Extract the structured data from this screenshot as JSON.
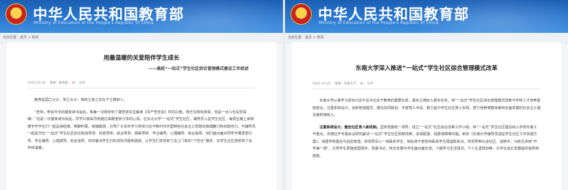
{
  "site": {
    "title": "中华人民共和国教育部",
    "subtitle": "Ministry of Education of the People's Republic of China"
  },
  "left": {
    "breadcrumb": "当前位置：首页 > 新闻",
    "title": "用最温暖的关爱陪伴学生成长",
    "subtitle": "——高校“一站式”学生社区综合管理模式建设工作综述",
    "meta": {
      "date": "2022-10-29",
      "source": "来源：教育部",
      "share": "分享"
    },
    "paragraphs": [
      "教育是国之大计、党之大计，高校立身之本在于立德树人。",
      "“老师，参加今天的建家读书会后，我第一次感受到了建筑道先生解读《共产党宣言》时的兴奋，既迁在我有收获、但是一点儿也没觉得晦！”这是一次建家读书会后，同学兴高采烈地跑过来跟老师分享的心情。在东北大学“一站式”学生社区，辅导员入驻学生社区，每周五晚上来到楼宇开学生们一起品读经典、畅聊时事、答疑解惑，引导广大青年学习贯彻习近平新时代中国特色社会主义思想的真理魅力和实践伟力。与辅导员一起驻守在“一站式”学生社区的还有班导师、科技导师、就业导师、朋辈导师、学业辅导、心理辅导、就业指导，他们面对面对同学开展思想引导、学业辅导、心理疏导、就业指导，实时解决学生们的现实问题和困惑，让学生们享受到了这上门来的“个性化”服务，在学生社区感受到了关怀和温暖。"
    ]
  },
  "right": {
    "breadcrumb": "当前位置：首页 > 新闻",
    "title": "东南大学深入推进“一站式”学生社区综合管理模式改革",
    "meta": {
      "date": "2022-10-30",
      "source": "来源：东南大学",
      "share": "分享"
    },
    "paragraphs": [
      {
        "lead": "",
        "text": "东南大学认真学习贯彻习近平总书记关于教育的重要论述，落实立德树人根本任务，将“一站式”学生社区综合管理模式改革与学校人才培养紧密结合，注重系统设计、创新管理模式、强化协同联动、丰富育人手段，着力提升学生社区育人实效，努力培养德智体美劳全面发展的社会主义建设者和接班人。"
      },
      {
        "lead": "注重系统设计，健全社区育人新机制。",
        "text": "坚持党委统一领导，成立“一站式”社区综合改革工作小组，将“一站式”学生社区建设纳入学校年度工作重点，定期召开专题会议研究解决“一站式”学生社区机制改革、资源配置、经费保障等问题。制定《东南大学辅导员进驻学生社区工作实施方案》，加强学院建设与进驻管理，校领导深入一线联系学生，院处级干部挂钩联系学生寝室联系点，校领导带头进社区、进楼宇，为新生讲授“开学第一课”，引导学生厚植家国情怀。党委书记、校长定期与学生面对面交流，了解学习生活情况、个人生涯规划等，为学生成长发展提供指导和帮助。"
      }
    ]
  }
}
